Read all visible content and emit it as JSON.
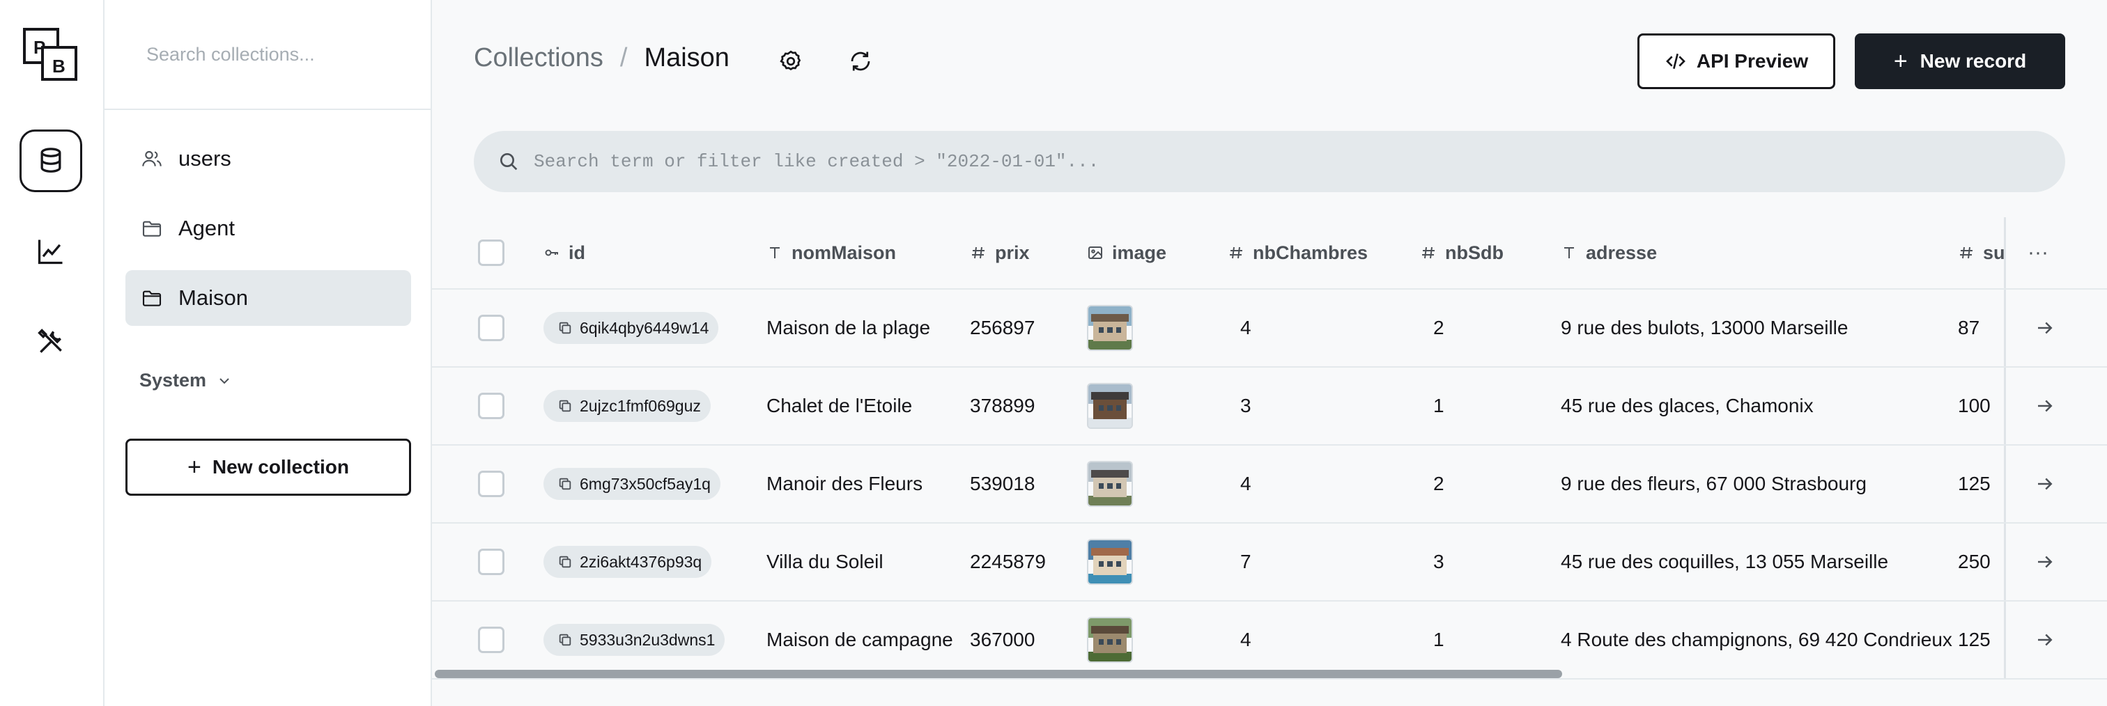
{
  "rail": {
    "logo_text": "PB",
    "items": [
      {
        "name": "collections",
        "icon": "database-icon",
        "active": true
      },
      {
        "name": "logs",
        "icon": "chart-line-icon",
        "active": false
      },
      {
        "name": "settings",
        "icon": "tools-icon",
        "active": false
      }
    ]
  },
  "sidebar": {
    "search_placeholder": "Search collections...",
    "items": [
      {
        "label": "users",
        "icon": "users-icon",
        "active": false
      },
      {
        "label": "Agent",
        "icon": "folder-icon",
        "active": false
      },
      {
        "label": "Maison",
        "icon": "folder-icon",
        "active": true
      }
    ],
    "system_label": "System",
    "new_collection_label": "New collection"
  },
  "header": {
    "breadcrumb_root": "Collections",
    "breadcrumb_sep": "/",
    "breadcrumb_current": "Maison",
    "api_preview_label": "API Preview",
    "new_record_label": "New record"
  },
  "filter": {
    "placeholder": "Search term or filter like created > \"2022-01-01\"..."
  },
  "table": {
    "columns": [
      {
        "key": "id",
        "label": "id",
        "icon": "key-icon"
      },
      {
        "key": "nomMaison",
        "label": "nomMaison",
        "icon": "text-icon"
      },
      {
        "key": "prix",
        "label": "prix",
        "icon": "hash-icon"
      },
      {
        "key": "image",
        "label": "image",
        "icon": "image-icon"
      },
      {
        "key": "nbChambres",
        "label": "nbChambres",
        "icon": "hash-icon"
      },
      {
        "key": "nbSdb",
        "label": "nbSdb",
        "icon": "hash-icon"
      },
      {
        "key": "adresse",
        "label": "adresse",
        "icon": "text-icon"
      },
      {
        "key": "su",
        "label": "su",
        "icon": "hash-icon"
      }
    ],
    "more_label": "···",
    "rows": [
      {
        "id": "6qik4qby6449w14",
        "nomMaison": "Maison de la plage",
        "prix": "256897",
        "nbChambres": "4",
        "nbSdb": "2",
        "adresse": "9 rue des bulots, 13000 Marseille",
        "su": "87",
        "thumb": {
          "sky": "#8fb2c9",
          "house": "#c9b59a",
          "roof": "#6d5b4a",
          "ground": "#5f7a4a"
        }
      },
      {
        "id": "2ujzc1fmf069guz",
        "nomMaison": "Chalet de l'Etoile",
        "prix": "378899",
        "nbChambres": "3",
        "nbSdb": "1",
        "adresse": "45 rue des glaces, Chamonix",
        "su": "100",
        "thumb": {
          "sky": "#a9bccc",
          "house": "#6b4f3a",
          "roof": "#3e3b3b",
          "ground": "#dfe5ea"
        }
      },
      {
        "id": "6mg73x50cf5ay1q",
        "nomMaison": "Manoir des Fleurs",
        "prix": "539018",
        "nbChambres": "4",
        "nbSdb": "2",
        "adresse": "9 rue des fleurs, 67 000 Strasbourg",
        "su": "125",
        "thumb": {
          "sky": "#b9c4cc",
          "house": "#d2c6b3",
          "roof": "#4d4a4a",
          "ground": "#6f7f56"
        }
      },
      {
        "id": "2zi6akt4376p93q",
        "nomMaison": "Villa du Soleil",
        "prix": "2245879",
        "nbChambres": "7",
        "nbSdb": "3",
        "adresse": "45 rue des coquilles, 13 055 Marseille",
        "su": "250",
        "thumb": {
          "sky": "#4f7fa6",
          "house": "#e2d3bb",
          "roof": "#a0694a",
          "ground": "#3f8fb5"
        }
      },
      {
        "id": "5933u3n2u3dwns1",
        "nomMaison": "Maison de campagne",
        "prix": "367000",
        "nbChambres": "4",
        "nbSdb": "1",
        "adresse": "4 Route des champignons, 69 420 Condrieux",
        "su": "125",
        "thumb": {
          "sky": "#7e9a6a",
          "house": "#9c8a6e",
          "roof": "#5a4a3a",
          "ground": "#4d6b35"
        }
      }
    ]
  }
}
